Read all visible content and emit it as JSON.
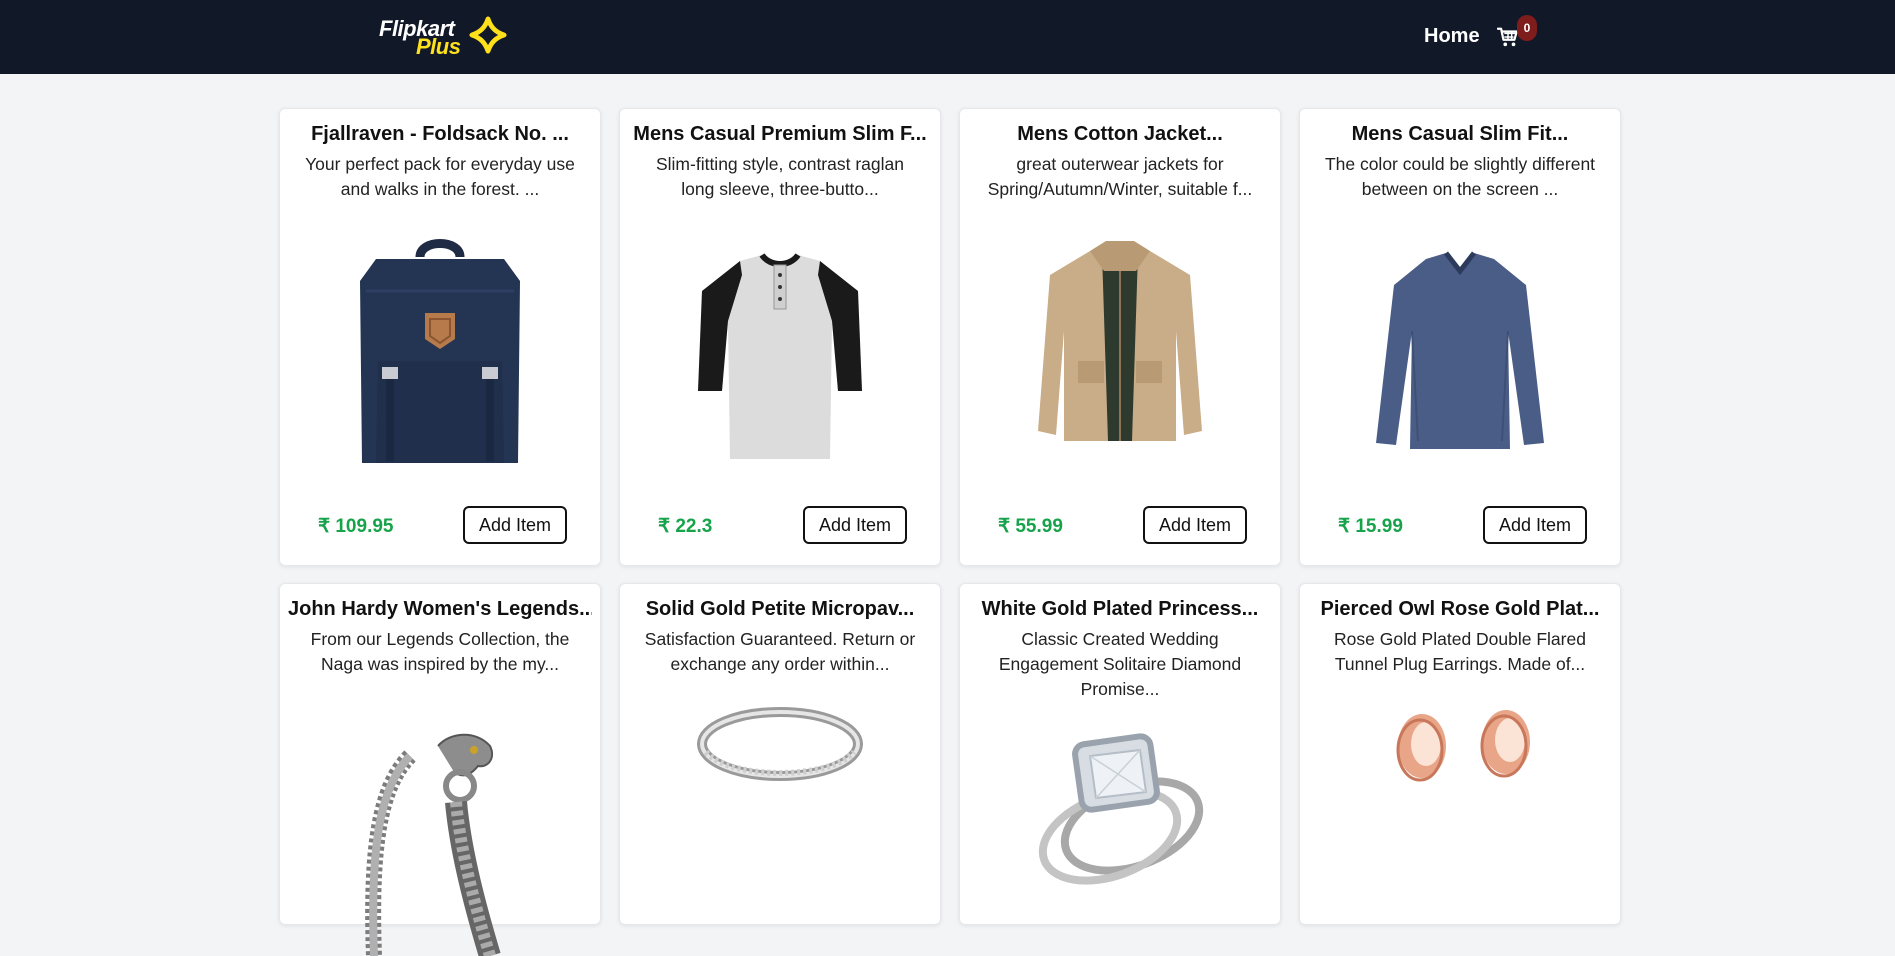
{
  "brand": {
    "line1": "Flipkart",
    "line2": "Plus",
    "accent_color": "#ffe11b"
  },
  "nav": {
    "home_label": "Home",
    "cart_icon": "cart-icon",
    "cart_count": "0"
  },
  "currency": "₹",
  "add_button_label": "Add Item",
  "products": [
    {
      "title": "Fjallraven - Foldsack No. ...",
      "description": "Your perfect pack for everyday use and walks in the forest. ...",
      "price": "₹ 109.95",
      "image": "backpack"
    },
    {
      "title": "Mens Casual Premium Slim F...",
      "description": "Slim-fitting style, contrast raglan long sleeve, three-butto...",
      "price": "₹ 22.3",
      "image": "raglan-tshirt"
    },
    {
      "title": "Mens Cotton Jacket...",
      "description": "great outerwear jackets for Spring/Autumn/Winter, suitable f...",
      "price": "₹ 55.99",
      "image": "cotton-jacket"
    },
    {
      "title": "Mens Casual Slim Fit...",
      "description": "The color could be slightly different between on the screen ...",
      "price": "₹ 15.99",
      "image": "long-sleeve-shirt"
    },
    {
      "title": "John Hardy Women's Legends...",
      "description": "From our Legends Collection, the Naga was inspired by the my...",
      "image": "dragon-bracelet"
    },
    {
      "title": "Solid Gold Petite Micropav...",
      "description": "Satisfaction Guaranteed. Return or exchange any order within...",
      "image": "silver-ring"
    },
    {
      "title": "White Gold Plated Princess...",
      "description": "Classic Created Wedding Engagement Solitaire Diamond Promise...",
      "image": "diamond-ring"
    },
    {
      "title": "Pierced Owl Rose Gold Plat...",
      "description": "Rose Gold Plated Double Flared Tunnel Plug Earrings. Made of...",
      "image": "rose-gold-plugs"
    }
  ]
}
